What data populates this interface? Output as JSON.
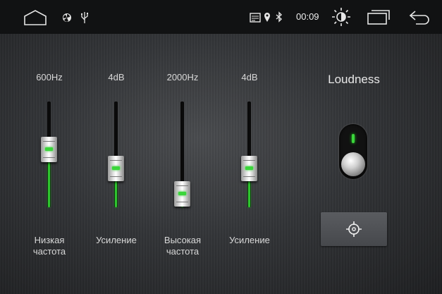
{
  "statusbar": {
    "time": "00:09",
    "icons": [
      "home-icon",
      "fan-icon",
      "usb-icon",
      "cast-icon",
      "location-icon",
      "bluetooth-icon",
      "brightness-icon",
      "recent-apps-icon",
      "back-icon"
    ]
  },
  "equalizer": {
    "bands": [
      {
        "value_label": "600Hz",
        "name_line1": "Низкая",
        "name_line2": "частота",
        "level": 0.55
      },
      {
        "value_label": "4dB",
        "name_line1": "Усиление",
        "name_line2": "",
        "level": 0.37
      },
      {
        "value_label": "2000Hz",
        "name_line1": "Высокая",
        "name_line2": "частота",
        "level": 0.13
      },
      {
        "value_label": "4dB",
        "name_line1": "Усиление",
        "name_line2": "",
        "level": 0.37
      }
    ]
  },
  "loudness": {
    "title": "Loudness",
    "enabled": true
  },
  "colors": {
    "accent": "#2fc52f",
    "statusbar_bg": "#111213"
  }
}
